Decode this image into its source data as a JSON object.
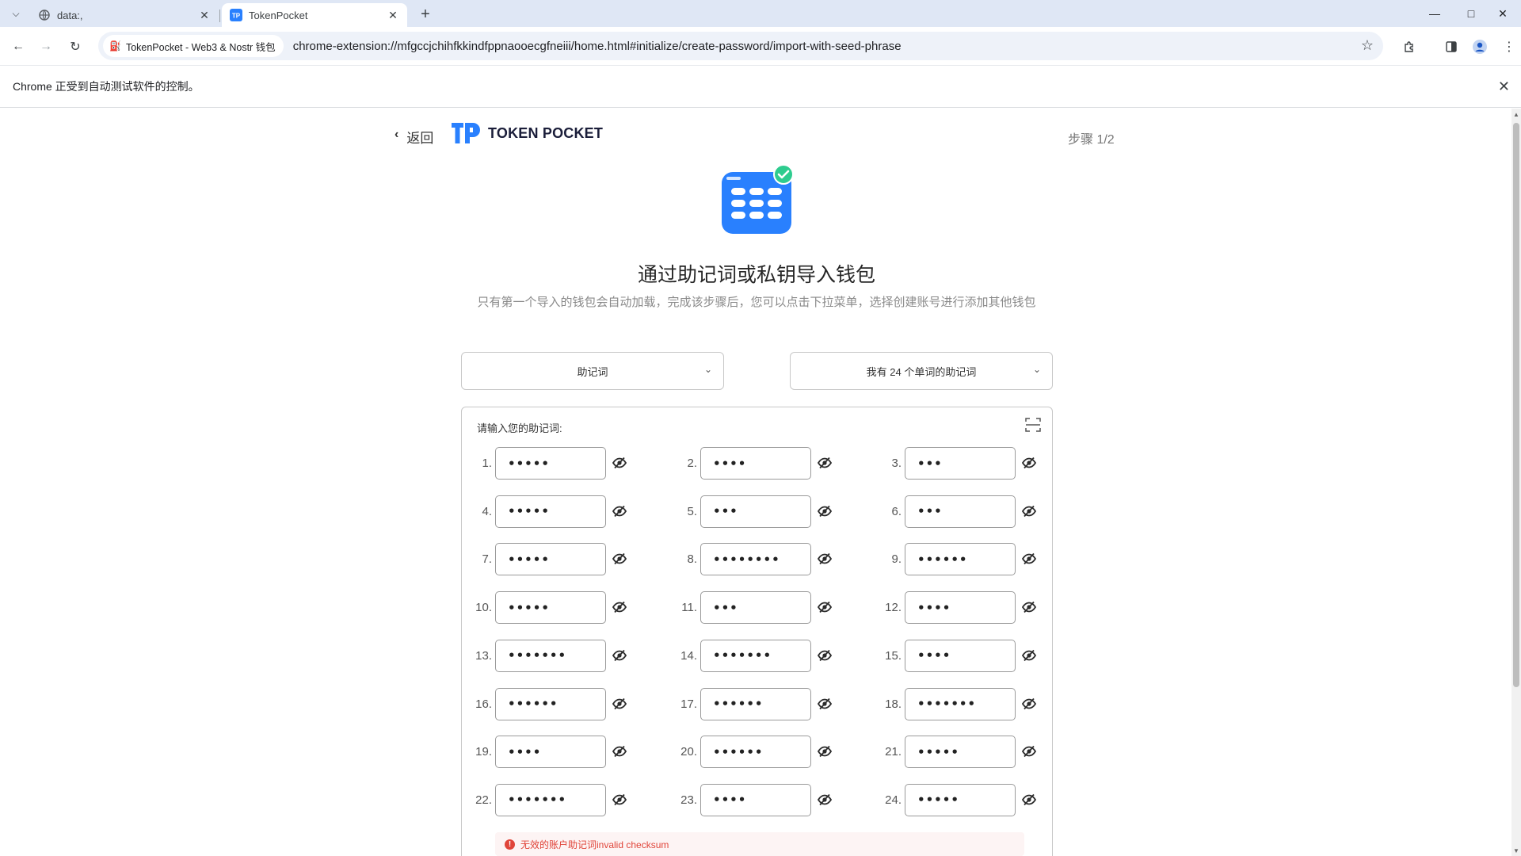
{
  "browser": {
    "tabs": [
      {
        "title": "data:,",
        "favicon": "globe-icon"
      },
      {
        "title": "TokenPocket",
        "favicon": "tp-logo-icon"
      }
    ],
    "site_chip": "TokenPocket - Web3 & Nostr 钱包",
    "url": "chrome-extension://mfgccjchihfkkindfppnaooecgfneiii/home.html#initialize/create-password/import-with-seed-phrase",
    "infobar_text": "Chrome 正受到自动测试软件的控制。"
  },
  "header": {
    "back_label": "返回",
    "brand": "TOKEN POCKET",
    "step": "步骤 1/2"
  },
  "content": {
    "title": "通过助记词或私钥导入钱包",
    "subtitle": "只有第一个导入的钱包会自动加载，完成该步骤后，您可以点击下拉菜单，选择创建账号进行添加其他钱包",
    "import_type": "助记词",
    "word_count_option": "我有 24 个单词的助记词",
    "phrase_label": "请输入您的助记词:",
    "error": "无效的账户助记词invalid checksum"
  },
  "words": [
    {
      "num": "1.",
      "value": "•••••"
    },
    {
      "num": "2.",
      "value": "••••"
    },
    {
      "num": "3.",
      "value": "•••"
    },
    {
      "num": "4.",
      "value": "•••••"
    },
    {
      "num": "5.",
      "value": "•••"
    },
    {
      "num": "6.",
      "value": "•••"
    },
    {
      "num": "7.",
      "value": "•••••"
    },
    {
      "num": "8.",
      "value": "••••••••"
    },
    {
      "num": "9.",
      "value": "••••••"
    },
    {
      "num": "10.",
      "value": "•••••"
    },
    {
      "num": "11.",
      "value": "•••"
    },
    {
      "num": "12.",
      "value": "••••"
    },
    {
      "num": "13.",
      "value": "•••••••"
    },
    {
      "num": "14.",
      "value": "•••••••"
    },
    {
      "num": "15.",
      "value": "••••"
    },
    {
      "num": "16.",
      "value": "••••••"
    },
    {
      "num": "17.",
      "value": "••••••"
    },
    {
      "num": "18.",
      "value": "•••••••"
    },
    {
      "num": "19.",
      "value": "••••"
    },
    {
      "num": "20.",
      "value": "••••••"
    },
    {
      "num": "21.",
      "value": "•••••"
    },
    {
      "num": "22.",
      "value": "•••••••"
    },
    {
      "num": "23.",
      "value": "••••"
    },
    {
      "num": "24.",
      "value": "•••••"
    }
  ],
  "colors": {
    "brand_blue": "#2980fe",
    "check_green": "#2ecc8f",
    "error_red": "#e0453a",
    "tabbar_bg": "#dfe7f5"
  }
}
